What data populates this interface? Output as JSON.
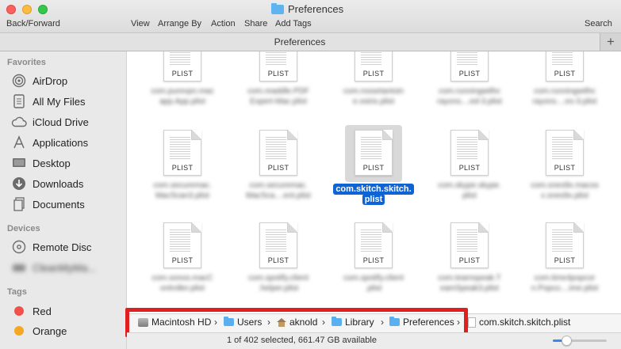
{
  "window": {
    "title": "Preferences",
    "title_icon": "folder-icon"
  },
  "toolbar": {
    "back_forward_label": "Back/Forward",
    "view_label": "View",
    "arrange_label": "Arrange By",
    "action_label": "Action",
    "share_label": "Share",
    "tags_label": "Add Tags",
    "search_label": "Search"
  },
  "tabbar": {
    "tab_label": "Preferences",
    "add_label": "+"
  },
  "sidebar": {
    "favorites_header": "Favorites",
    "favorites": [
      {
        "label": "AirDrop",
        "icon": "airdrop-icon"
      },
      {
        "label": "All My Files",
        "icon": "all-files-icon"
      },
      {
        "label": "iCloud Drive",
        "icon": "cloud-icon"
      },
      {
        "label": "Applications",
        "icon": "applications-icon"
      },
      {
        "label": "Desktop",
        "icon": "desktop-icon"
      },
      {
        "label": "Downloads",
        "icon": "downloads-icon"
      },
      {
        "label": "Documents",
        "icon": "documents-icon"
      }
    ],
    "devices_header": "Devices",
    "devices": [
      {
        "label": "Remote Disc",
        "icon": "disc-icon"
      },
      {
        "label": "CleanMyMa...",
        "icon": "drive-icon"
      }
    ],
    "tags_header": "Tags",
    "tags": [
      {
        "label": "Red",
        "color": "#f0514b"
      },
      {
        "label": "Orange",
        "color": "#f5a623"
      }
    ]
  },
  "files": {
    "type_label": "PLIST",
    "items": [
      {
        "name_l1": "com.purevpn.mac",
        "name_l2": "app.App.plist"
      },
      {
        "name_l1": "com.readdle.PDF",
        "name_l2": "Expert-Mac.plist"
      },
      {
        "name_l1": "com.rossetantoin",
        "name_l2": "e.osirix.plist"
      },
      {
        "name_l1": "com.runningwithc",
        "name_l2": "rayons....ed-3.plist"
      },
      {
        "name_l1": "com.runningwithc",
        "name_l2": "rayons....es-3.plist"
      },
      {
        "name_l1": "com.securemac.",
        "name_l2": "MacScan3.plist"
      },
      {
        "name_l1": "com.securemac.",
        "name_l2": "MacSca....ent.plist"
      },
      {
        "name_l1": "com.skitch.skitch.",
        "name_l2": "plist",
        "selected": true
      },
      {
        "name_l1": "com.skype.skype.",
        "name_l2": "plist"
      },
      {
        "name_l1": "com.snes9x.macos",
        "name_l2": "x.snes9x.plist"
      },
      {
        "name_l1": "com.sonos.macC",
        "name_l2": "ontroller.plist"
      },
      {
        "name_l1": "com.spotify.client",
        "name_l2": ".helper.plist"
      },
      {
        "name_l1": "com.spotify.client",
        "name_l2": ".plist"
      },
      {
        "name_l1": "com.teamspeak.T",
        "name_l2": "eamSpeak3.plist"
      },
      {
        "name_l1": "com.time4popcor",
        "name_l2": "n.Popco....ime.plist"
      }
    ]
  },
  "pathbar": {
    "items": [
      {
        "label": "Macintosh HD",
        "icon": "hard-drive-icon"
      },
      {
        "label": "Users",
        "icon": "folder-icon"
      },
      {
        "label": "aknold",
        "icon": "home-icon"
      },
      {
        "label": "Library",
        "icon": "folder-icon"
      },
      {
        "label": "Preferences",
        "icon": "folder-icon"
      },
      {
        "label": "com.skitch.skitch.plist",
        "icon": "file-icon"
      }
    ],
    "separator": "›",
    "highlight_color": "#e02020"
  },
  "status": {
    "text": "1 of 402 selected, 661.47 GB available",
    "icon_size_level": 0.25
  },
  "colors": {
    "selection": "#0e63d5",
    "slider_accent": "#3b86f7"
  }
}
